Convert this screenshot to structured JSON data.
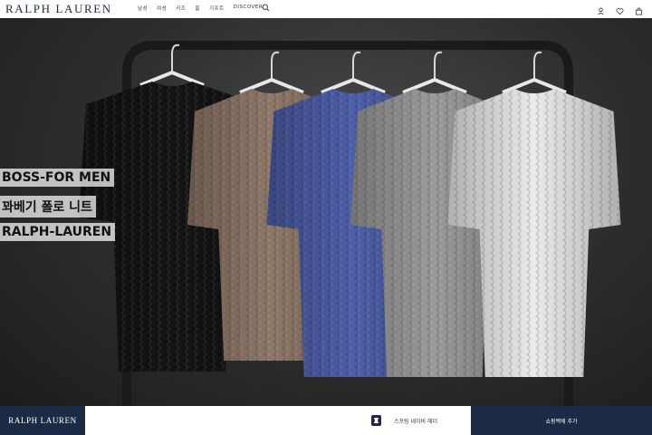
{
  "brand": {
    "logo_text": "RALPH LAUREN"
  },
  "nav": {
    "items": [
      {
        "label": "남성"
      },
      {
        "label": "여성"
      },
      {
        "label": "키즈"
      },
      {
        "label": "홈"
      },
      {
        "label": "기프트"
      },
      {
        "label": "DISCOVER"
      }
    ]
  },
  "hero": {
    "overlay_lines": [
      "BOSS-FOR MEN",
      "꽈베기 폴로 니트",
      "RALPH-LAUREN"
    ],
    "sweater_colors": [
      "#141414",
      "#8e7767",
      "#4c5ea8",
      "#9a9a9a",
      "#eaeaea"
    ]
  },
  "bottom_bar": {
    "logo_text": "RALPH LAUREN",
    "product_name": "스프링 네이비 헤더",
    "cart_label": "쇼핑백에 추가"
  },
  "colors": {
    "brand_navy": "#1b2b45"
  }
}
